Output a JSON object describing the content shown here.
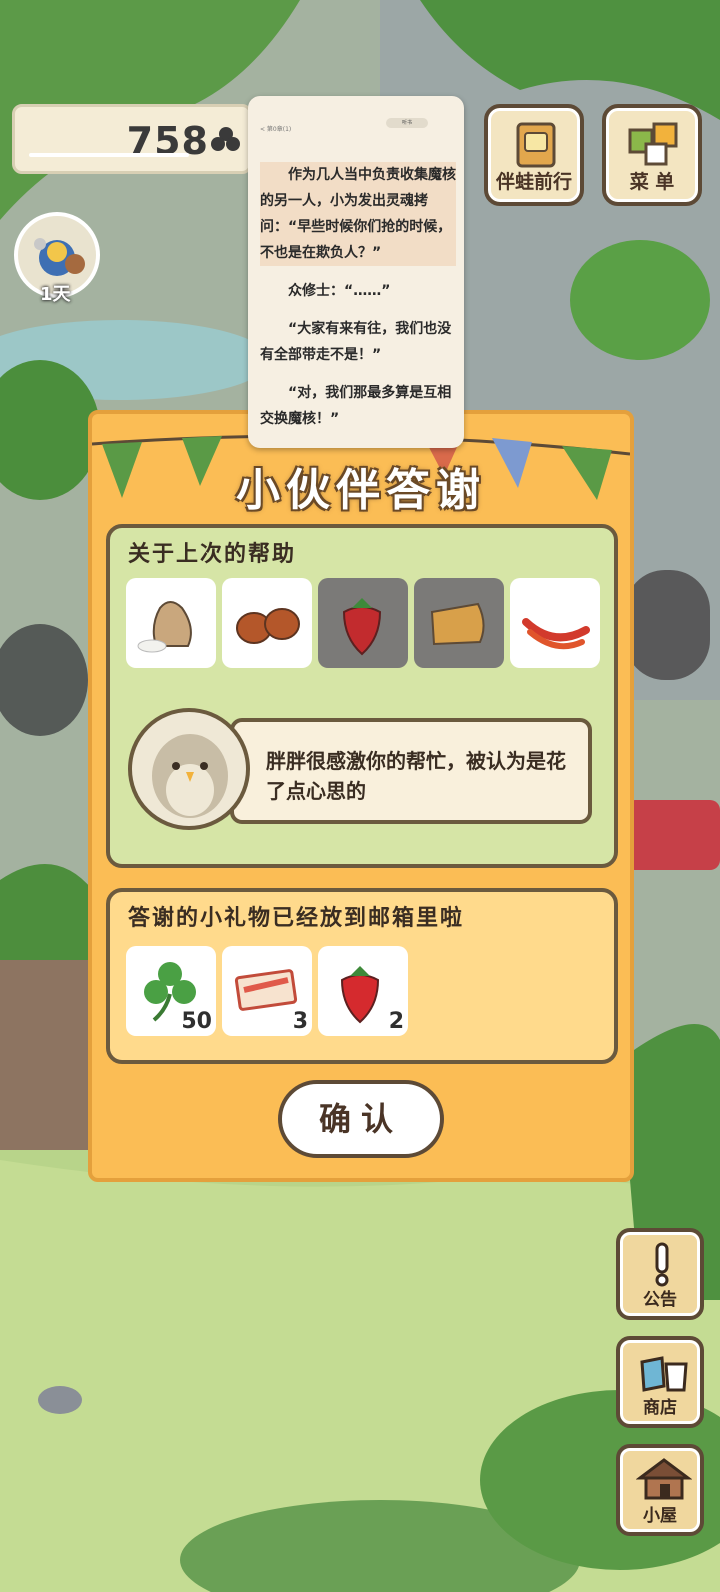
{
  "hud": {
    "clover_count": "758",
    "day_label": "1天"
  },
  "top_buttons": [
    {
      "label": "伴蛙前行"
    },
    {
      "label": "菜 单"
    }
  ],
  "side_buttons": [
    {
      "label": "公告"
    },
    {
      "label": "商店"
    },
    {
      "label": "小屋"
    }
  ],
  "overlay_article": {
    "chapter": "< 第0章(1)",
    "pill": "听书",
    "paragraphs": [
      "作为几人当中负责收集魔核的另一人，小为发出灵魂拷问：“早些时候你们抢的时候，不也是在欺负人？”",
      "众修士：“……”",
      "“大家有来有往，我们也没有全部带走不是！”",
      "“对，我们那最多算是互相交换魔核！”"
    ]
  },
  "dialog": {
    "title": "小伙伴答谢",
    "help_heading": "关于上次的帮助",
    "help_items": [
      {
        "icon": "rice-sack-icon",
        "dimmed": false
      },
      {
        "icon": "chestnuts-icon",
        "dimmed": false
      },
      {
        "icon": "strawberry-icon",
        "dimmed": true
      },
      {
        "icon": "cheese-icon",
        "dimmed": true
      },
      {
        "icon": "chili-peppers-icon",
        "dimmed": false
      }
    ],
    "message": "胖胖很感激你的帮忙，被认为是花了点心思的",
    "gift_heading": "答谢的小礼物已经放到邮箱里啦",
    "gifts": [
      {
        "icon": "clover-icon",
        "count": "50"
      },
      {
        "icon": "ticket-icon",
        "count": "3"
      },
      {
        "icon": "strawberry-icon",
        "count": "2"
      }
    ],
    "confirm_label": "确认"
  },
  "colors": {
    "panel": "#fbbd55",
    "section_green": "#d6e5a6",
    "section_yellow": "#ffda8c",
    "border_brown": "#6b5a3e"
  }
}
